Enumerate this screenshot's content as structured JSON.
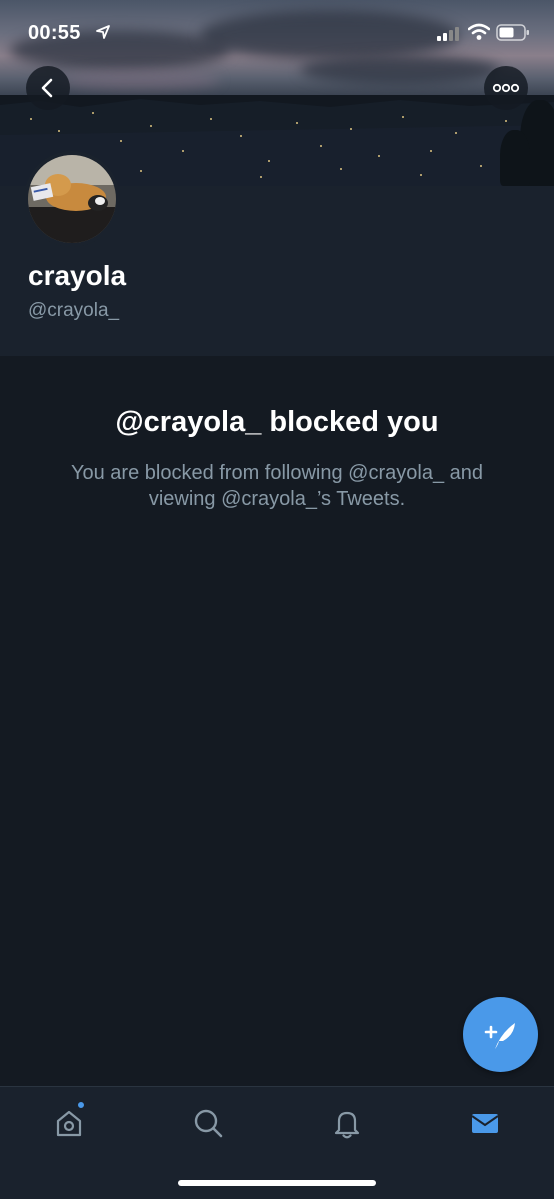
{
  "status_bar": {
    "time": "00:55"
  },
  "profile": {
    "display_name": "crayola",
    "handle": "@crayola_"
  },
  "blocked": {
    "title": "@crayola_ blocked you",
    "message": "You are blocked from following @crayola_ and viewing @crayola_’s Tweets."
  },
  "icons": {
    "back": "chevron-left-icon",
    "more": "more-dots-icon",
    "compose": "compose-tweet-icon",
    "home": "home-icon",
    "search": "search-icon",
    "notifications": "bell-icon",
    "messages": "envelope-icon"
  },
  "colors": {
    "background": "#141a22",
    "profile_background": "#1a222d",
    "accent": "#4a99e9",
    "secondary_text": "#8899a6"
  }
}
